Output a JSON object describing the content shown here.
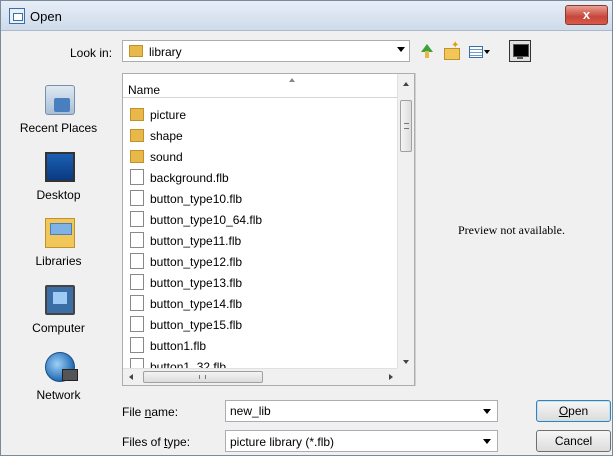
{
  "window": {
    "title": "Open",
    "close_glyph": "x"
  },
  "toolbar": {
    "look_in_label": "Look in:",
    "look_in_value": "library"
  },
  "places": [
    "Recent Places",
    "Desktop",
    "Libraries",
    "Computer",
    "Network"
  ],
  "list": {
    "column_name": "Name",
    "items": [
      {
        "name": "picture",
        "kind": "folder"
      },
      {
        "name": "shape",
        "kind": "folder"
      },
      {
        "name": "sound",
        "kind": "folder"
      },
      {
        "name": "background.flb",
        "kind": "file"
      },
      {
        "name": "button_type10.flb",
        "kind": "file"
      },
      {
        "name": "button_type10_64.flb",
        "kind": "file"
      },
      {
        "name": "button_type11.flb",
        "kind": "file"
      },
      {
        "name": "button_type12.flb",
        "kind": "file"
      },
      {
        "name": "button_type13.flb",
        "kind": "file"
      },
      {
        "name": "button_type14.flb",
        "kind": "file"
      },
      {
        "name": "button_type15.flb",
        "kind": "file"
      },
      {
        "name": "button1.flb",
        "kind": "file"
      },
      {
        "name": "button1_32.flb",
        "kind": "file"
      }
    ],
    "hscroll_grip": "III"
  },
  "preview": {
    "text": "Preview not available."
  },
  "bottom": {
    "file_name_label": "File name:",
    "file_name_value": "new_lib",
    "file_type_label": "Files of type:",
    "file_type_value": "picture library (*.flb)",
    "open_label": "Open",
    "cancel_label": "Cancel"
  }
}
